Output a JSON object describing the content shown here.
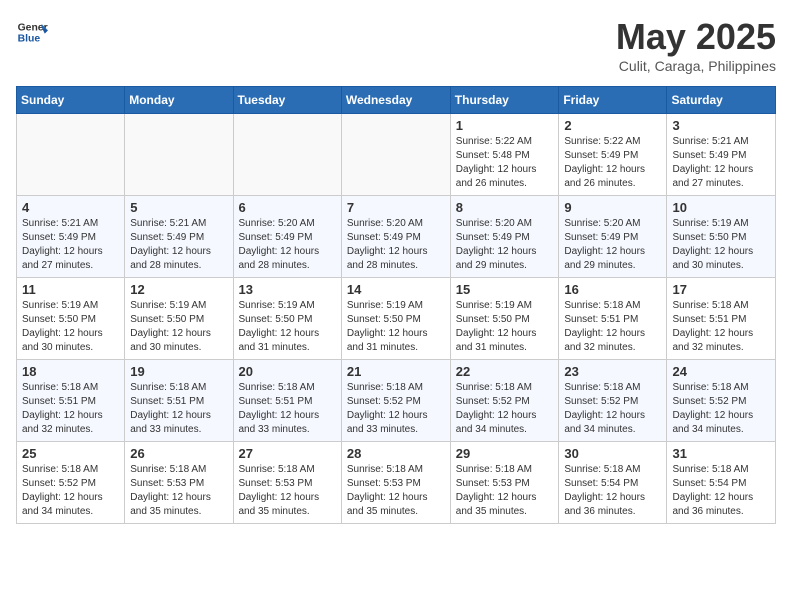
{
  "header": {
    "logo_general": "General",
    "logo_blue": "Blue",
    "month_title": "May 2025",
    "location": "Culit, Caraga, Philippines"
  },
  "weekdays": [
    "Sunday",
    "Monday",
    "Tuesday",
    "Wednesday",
    "Thursday",
    "Friday",
    "Saturday"
  ],
  "weeks": [
    [
      {
        "day": "",
        "info": ""
      },
      {
        "day": "",
        "info": ""
      },
      {
        "day": "",
        "info": ""
      },
      {
        "day": "",
        "info": ""
      },
      {
        "day": "1",
        "info": "Sunrise: 5:22 AM\nSunset: 5:48 PM\nDaylight: 12 hours\nand 26 minutes."
      },
      {
        "day": "2",
        "info": "Sunrise: 5:22 AM\nSunset: 5:49 PM\nDaylight: 12 hours\nand 26 minutes."
      },
      {
        "day": "3",
        "info": "Sunrise: 5:21 AM\nSunset: 5:49 PM\nDaylight: 12 hours\nand 27 minutes."
      }
    ],
    [
      {
        "day": "4",
        "info": "Sunrise: 5:21 AM\nSunset: 5:49 PM\nDaylight: 12 hours\nand 27 minutes."
      },
      {
        "day": "5",
        "info": "Sunrise: 5:21 AM\nSunset: 5:49 PM\nDaylight: 12 hours\nand 28 minutes."
      },
      {
        "day": "6",
        "info": "Sunrise: 5:20 AM\nSunset: 5:49 PM\nDaylight: 12 hours\nand 28 minutes."
      },
      {
        "day": "7",
        "info": "Sunrise: 5:20 AM\nSunset: 5:49 PM\nDaylight: 12 hours\nand 28 minutes."
      },
      {
        "day": "8",
        "info": "Sunrise: 5:20 AM\nSunset: 5:49 PM\nDaylight: 12 hours\nand 29 minutes."
      },
      {
        "day": "9",
        "info": "Sunrise: 5:20 AM\nSunset: 5:49 PM\nDaylight: 12 hours\nand 29 minutes."
      },
      {
        "day": "10",
        "info": "Sunrise: 5:19 AM\nSunset: 5:50 PM\nDaylight: 12 hours\nand 30 minutes."
      }
    ],
    [
      {
        "day": "11",
        "info": "Sunrise: 5:19 AM\nSunset: 5:50 PM\nDaylight: 12 hours\nand 30 minutes."
      },
      {
        "day": "12",
        "info": "Sunrise: 5:19 AM\nSunset: 5:50 PM\nDaylight: 12 hours\nand 30 minutes."
      },
      {
        "day": "13",
        "info": "Sunrise: 5:19 AM\nSunset: 5:50 PM\nDaylight: 12 hours\nand 31 minutes."
      },
      {
        "day": "14",
        "info": "Sunrise: 5:19 AM\nSunset: 5:50 PM\nDaylight: 12 hours\nand 31 minutes."
      },
      {
        "day": "15",
        "info": "Sunrise: 5:19 AM\nSunset: 5:50 PM\nDaylight: 12 hours\nand 31 minutes."
      },
      {
        "day": "16",
        "info": "Sunrise: 5:18 AM\nSunset: 5:51 PM\nDaylight: 12 hours\nand 32 minutes."
      },
      {
        "day": "17",
        "info": "Sunrise: 5:18 AM\nSunset: 5:51 PM\nDaylight: 12 hours\nand 32 minutes."
      }
    ],
    [
      {
        "day": "18",
        "info": "Sunrise: 5:18 AM\nSunset: 5:51 PM\nDaylight: 12 hours\nand 32 minutes."
      },
      {
        "day": "19",
        "info": "Sunrise: 5:18 AM\nSunset: 5:51 PM\nDaylight: 12 hours\nand 33 minutes."
      },
      {
        "day": "20",
        "info": "Sunrise: 5:18 AM\nSunset: 5:51 PM\nDaylight: 12 hours\nand 33 minutes."
      },
      {
        "day": "21",
        "info": "Sunrise: 5:18 AM\nSunset: 5:52 PM\nDaylight: 12 hours\nand 33 minutes."
      },
      {
        "day": "22",
        "info": "Sunrise: 5:18 AM\nSunset: 5:52 PM\nDaylight: 12 hours\nand 34 minutes."
      },
      {
        "day": "23",
        "info": "Sunrise: 5:18 AM\nSunset: 5:52 PM\nDaylight: 12 hours\nand 34 minutes."
      },
      {
        "day": "24",
        "info": "Sunrise: 5:18 AM\nSunset: 5:52 PM\nDaylight: 12 hours\nand 34 minutes."
      }
    ],
    [
      {
        "day": "25",
        "info": "Sunrise: 5:18 AM\nSunset: 5:52 PM\nDaylight: 12 hours\nand 34 minutes."
      },
      {
        "day": "26",
        "info": "Sunrise: 5:18 AM\nSunset: 5:53 PM\nDaylight: 12 hours\nand 35 minutes."
      },
      {
        "day": "27",
        "info": "Sunrise: 5:18 AM\nSunset: 5:53 PM\nDaylight: 12 hours\nand 35 minutes."
      },
      {
        "day": "28",
        "info": "Sunrise: 5:18 AM\nSunset: 5:53 PM\nDaylight: 12 hours\nand 35 minutes."
      },
      {
        "day": "29",
        "info": "Sunrise: 5:18 AM\nSunset: 5:53 PM\nDaylight: 12 hours\nand 35 minutes."
      },
      {
        "day": "30",
        "info": "Sunrise: 5:18 AM\nSunset: 5:54 PM\nDaylight: 12 hours\nand 36 minutes."
      },
      {
        "day": "31",
        "info": "Sunrise: 5:18 AM\nSunset: 5:54 PM\nDaylight: 12 hours\nand 36 minutes."
      }
    ]
  ]
}
